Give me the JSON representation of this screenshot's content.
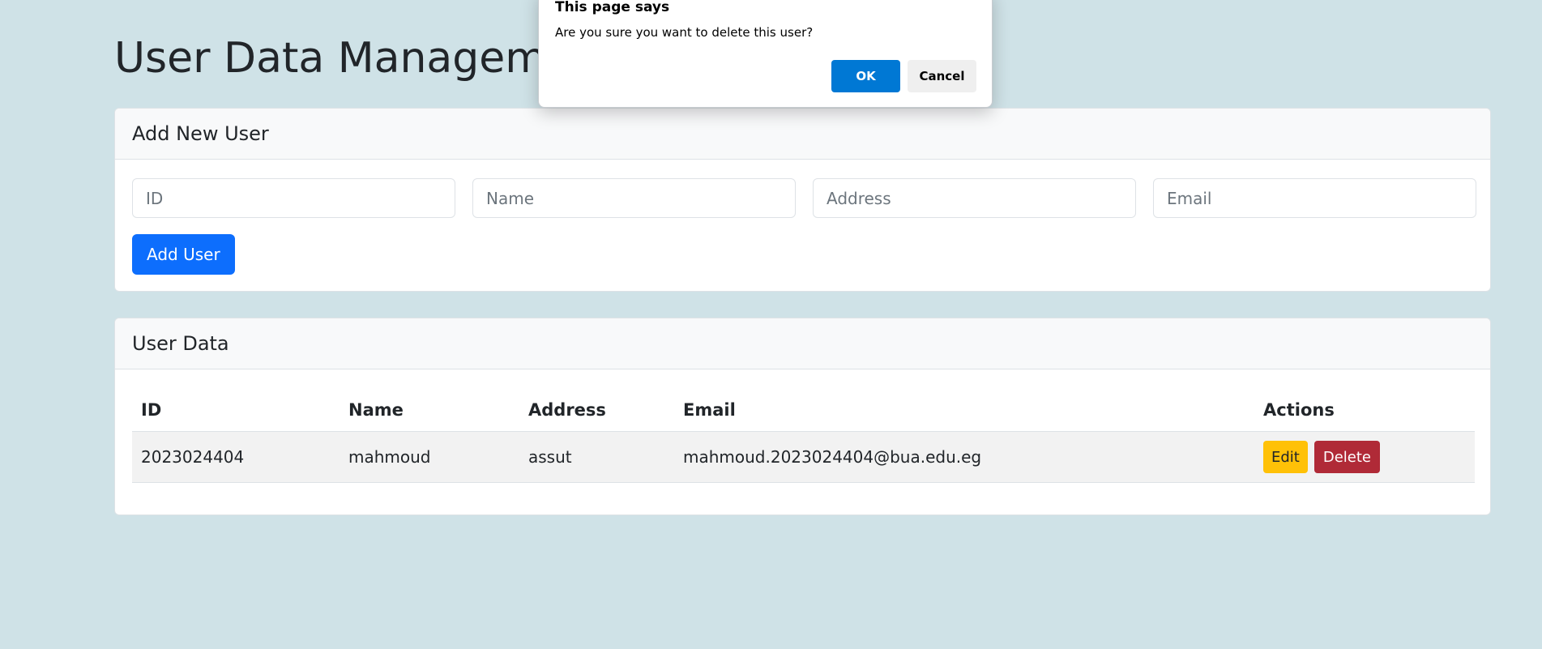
{
  "page": {
    "title": "User Data Management"
  },
  "add_user_card": {
    "header": "Add New User",
    "inputs": {
      "id": {
        "placeholder": "ID",
        "value": ""
      },
      "name": {
        "placeholder": "Name",
        "value": ""
      },
      "address": {
        "placeholder": "Address",
        "value": ""
      },
      "email": {
        "placeholder": "Email",
        "value": ""
      }
    },
    "add_button_label": "Add User"
  },
  "user_data_card": {
    "header": "User Data",
    "columns": [
      "ID",
      "Name",
      "Address",
      "Email",
      "Actions"
    ],
    "rows": [
      {
        "id": "2023024404",
        "name": "mahmoud",
        "address": "assut",
        "email": "mahmoud.2023024404@bua.edu.eg",
        "edit_label": "Edit",
        "delete_label": "Delete"
      }
    ]
  },
  "dialog": {
    "title": "This page says",
    "message": "Are you sure you want to delete this user?",
    "ok_label": "OK",
    "cancel_label": "Cancel"
  },
  "colors": {
    "background": "#cfe2e7",
    "primary": "#0d6efd",
    "warning": "#ffc107",
    "danger": "#b02a37",
    "dialog_ok": "#0078d4"
  }
}
